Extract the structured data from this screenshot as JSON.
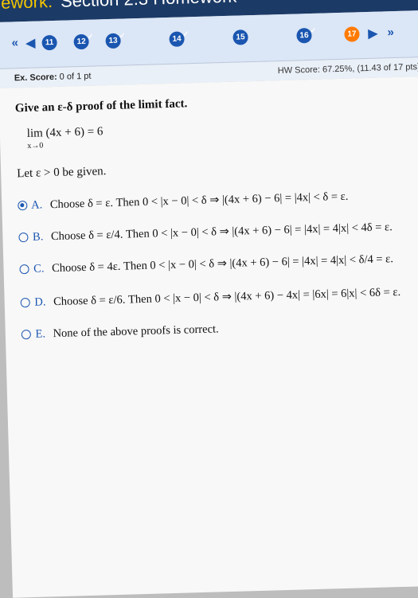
{
  "header": {
    "prefix": "ework:",
    "title": "Section 2.3 Homework"
  },
  "nav": {
    "first_icon": "double-chevron-left-icon",
    "prev_icon": "chevron-left-icon",
    "next_icon": "chevron-right-icon",
    "last_icon": "double-chevron-right-icon",
    "questions": [
      "11",
      "12",
      "13",
      "14",
      "15",
      "16",
      "17"
    ],
    "accent": "#1a56b0",
    "current_color": "#ff7a00"
  },
  "score": {
    "ex_label": "Ex. Score:",
    "ex_value": "0 of 1 pt",
    "hw_text": "HW Score: 67.25%, (11.43 of 17 pts)"
  },
  "question": {
    "prompt": "Give an ε-δ proof of the limit fact.",
    "limit": "lim (4x + 6) = 6",
    "limit_sub": "x→0",
    "given": "Let ε > 0 be given."
  },
  "options": [
    {
      "letter": "A.",
      "text": "Choose δ = ε. Then 0 < |x − 0| < δ ⇒ |(4x + 6) − 6| = |4x| < δ = ε."
    },
    {
      "letter": "B.",
      "text": "Choose δ = ε/4. Then 0 < |x − 0| < δ ⇒ |(4x + 6) − 6| = |4x| = 4|x| < 4δ = ε."
    },
    {
      "letter": "C.",
      "text": "Choose δ = 4ε. Then 0 < |x − 0| < δ ⇒ |(4x + 6) − 6| = |4x| = 4|x| < δ/4 = ε."
    },
    {
      "letter": "D.",
      "text": "Choose δ = ε/6. Then 0 < |x − 0| < δ ⇒ |(4x + 6) − 4x| = |6x| = 6|x| < 6δ = ε."
    },
    {
      "letter": "E.",
      "text": "None of the above proofs is correct."
    }
  ]
}
